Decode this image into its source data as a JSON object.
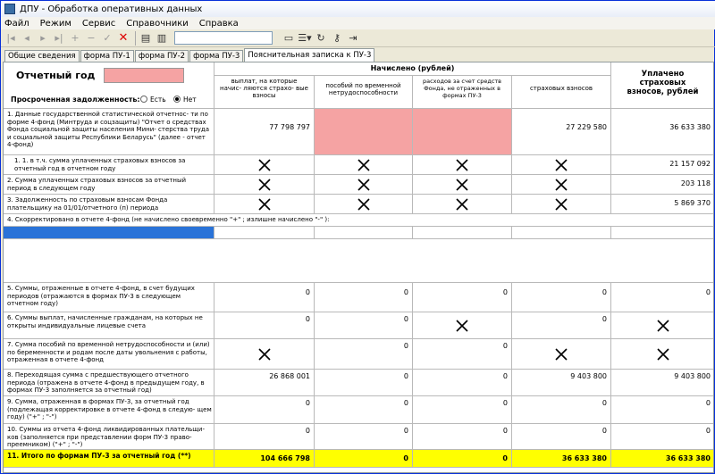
{
  "window": {
    "title": "ДПУ - Обработка оперативных данных"
  },
  "menu": [
    "Файл",
    "Режим",
    "Сервис",
    "Справочники",
    "Справка"
  ],
  "tabs": [
    "Общие сведения",
    "форма ПУ-1",
    "форма ПУ-2",
    "форма ПУ-3",
    "Пояснительная записка к ПУ-3"
  ],
  "header": {
    "report_year_label": "Отчетный год",
    "overdue_label": "Просроченная задолженность:",
    "radio_yes": "Есть",
    "radio_no": "Нет",
    "accrued_title": "Начислено (рублей)",
    "col1": "выплат, на которые начис- ляются страхо- вые взносы",
    "col2": "пособий по временной нетрудоспособности",
    "col3": "расходов за счет средств Фонда, не отраженных в формах ПУ-3",
    "col4": "страховых взносов",
    "col5": "Уплачено страховых взносов, рублей"
  },
  "rows": [
    {
      "label": "1. Данные государственной статистической отчетнос- ти по форме 4-фонд (Минтруда и соцзащиты) \"Отчет о средствах Фонда социальной защиты населения Мини- стерства труда и социальной защиты Республики Беларусь\" (далее - отчет 4-фонд)",
      "c1": "77 798 797",
      "c2": "",
      "c3": "",
      "c4": "27 229 580",
      "c5": "36 633 380"
    },
    {
      "label": "1. 1. в т.ч. сумма уплаченных страховых взносов за отчетный год в отчетном году",
      "c1": "",
      "c2": "",
      "c3": "",
      "c4": "",
      "c5": "21 157 092"
    },
    {
      "label": "2. Сумма уплаченных страховых взносов за отчетный период в следующем году",
      "c1": "",
      "c2": "",
      "c3": "",
      "c4": "",
      "c5": "203 118"
    },
    {
      "label": "3. Задолженность по страховым взносам Фонда плательщику на 01/01/отчетного (п) периода",
      "c1": "",
      "c2": "",
      "c3": "",
      "c4": "",
      "c5": "5 869 370"
    },
    {
      "label": "4. Скорректировано в отчете 4-фонд (не начислено своевременно \"+\" ; излишне начислено \"-\" ):"
    },
    {
      "label": "5. Суммы, отраженные в отчете 4-фонд, в счет будущих периодов (отражаются в формах ПУ-3 в следующем отчетном году)",
      "c1": "0",
      "c2": "0",
      "c3": "0",
      "c4": "0",
      "c5": "0"
    },
    {
      "label": "6. Суммы выплат, начисленные гражданам, на которых не открыты индивидуальные лицевые счета",
      "c1": "0",
      "c2": "0",
      "c3": "",
      "c4": "0",
      "c5": ""
    },
    {
      "label": "7. Сумма пособий по временной нетрудоспособности и (или) по беременности и родам после даты увольнения с работы, отраженная в отчете 4-фонд",
      "c1": "",
      "c2": "0",
      "c3": "0",
      "c4": "",
      "c5": ""
    },
    {
      "label": "8. Переходящая сумма с предшествующего отчетного периода (отражена в отчете 4-фонд в предыдущем году, в формах ПУ-3 заполняется за отчетный год)",
      "c1": "26 868 001",
      "c2": "0",
      "c3": "0",
      "c4": "9 403 800",
      "c5": "9 403 800"
    },
    {
      "label": "9. Сумма, отраженная в формах ПУ-3, за отчетный год (подлежащая корректировке в отчете 4-фонд в следую- щем году) (\"+\" ; \"-\")",
      "c1": "0",
      "c2": "0",
      "c3": "0",
      "c4": "0",
      "c5": "0"
    },
    {
      "label": "10. Суммы из отчета 4-фонд ликвидированных плательщи- ков (заполняется при представлении форм ПУ-3 право- преемником) (\"+\" ; \"-\")",
      "c1": "0",
      "c2": "0",
      "c3": "0",
      "c4": "0",
      "c5": "0"
    },
    {
      "label": "11. Итого по формам ПУ-3 за отчетный год (**)",
      "c1": "104 666 798",
      "c2": "0",
      "c3": "0",
      "c4": "36 633 380",
      "c5": "36 633 380"
    }
  ],
  "colors": {
    "pink": "#f5a3a3",
    "yellow": "#ffff00",
    "selection": "#2a73d8"
  }
}
